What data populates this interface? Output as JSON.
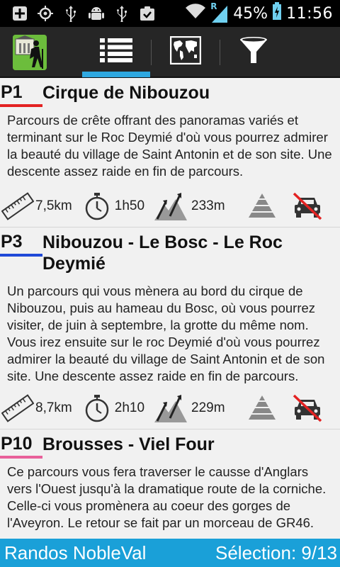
{
  "status_bar": {
    "battery": "45%",
    "time": "11:56",
    "network_type": "R",
    "icons": [
      "add-icon",
      "gps-icon",
      "usb-icon",
      "android-debug-icon",
      "usb-icon",
      "download-done-icon",
      "wifi-icon",
      "signal-icon",
      "battery-charging-icon"
    ]
  },
  "action_bar": {
    "tabs": [
      {
        "name": "list-icon",
        "selected": true
      },
      {
        "name": "map-icon",
        "selected": false
      },
      {
        "name": "filter-icon",
        "selected": false
      }
    ],
    "accent": "#2fa8e0"
  },
  "items": [
    {
      "code": "P1",
      "color": "#e32222",
      "title": "Cirque de Nibouzou",
      "description": "Parcours de crête offrant des panoramas variés et terminant sur le Roc Deymié d'où vous pourrez admirer la beauté du village de Saint Antonin et de son site. Une descente assez raide en fin de parcours.",
      "distance": "7,5km",
      "duration": "1h50",
      "elevation": "233m"
    },
    {
      "code": "P3",
      "color": "#1f49d8",
      "title": "Nibouzou - Le Bosc - Le Roc Deymié",
      "description": "Un parcours qui vous mènera au bord du cirque de Nibouzou, puis au hameau du Bosc, où vous pourrez visiter, de juin à septembre, la grotte du même nom. Vous irez ensuite sur le roc Deymié d'où vous pourrez admirer la beauté du village de Saint Antonin et de son site. Une descente assez raide en fin de parcours.",
      "distance": "8,7km",
      "duration": "2h10",
      "elevation": "229m"
    },
    {
      "code": "P10",
      "color": "#e8609a",
      "title": "Brousses - Viel Four",
      "description": "Ce parcours vous fera traverser le causse d'Anglars vers l'Ouest jusqu'à la dramatique route de la corniche. Celle-ci vous promènera au coeur des gorges de l'Aveyron. Le retour se fait par un morceau de GR46.",
      "distance": "",
      "duration": "",
      "elevation": ""
    }
  ],
  "bottom_bar": {
    "app_name": "Randos NobleVal",
    "selection": "Sélection: 9/13",
    "color": "#1aa0d8"
  }
}
